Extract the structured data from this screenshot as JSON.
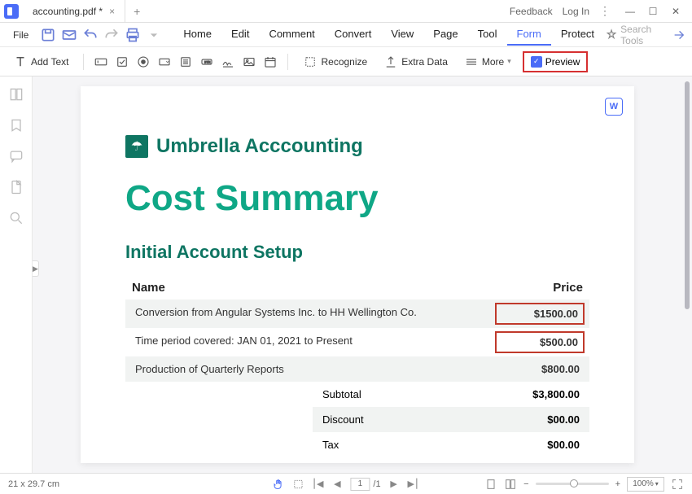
{
  "titlebar": {
    "tab": "accounting.pdf *",
    "feedback": "Feedback",
    "login": "Log In"
  },
  "menubar": {
    "file": "File",
    "items": [
      "Home",
      "Edit",
      "Comment",
      "Convert",
      "View",
      "Page",
      "Tool",
      "Form",
      "Protect"
    ],
    "active_index": 7,
    "search_placeholder": "Search Tools"
  },
  "toolbar": {
    "add_text": "Add Text",
    "recognize": "Recognize",
    "extra_data": "Extra Data",
    "more": "More",
    "preview": "Preview"
  },
  "document": {
    "brand": "Umbrella Acccounting",
    "title": "Cost Summary",
    "section": "Initial Account Setup",
    "headers": {
      "name": "Name",
      "price": "Price"
    },
    "rows": [
      {
        "name": "Conversion from Angular Systems Inc. to HH Wellington Co.",
        "price": "$1500.00",
        "highlight": true,
        "shade": true
      },
      {
        "name": "Time period covered: JAN 01, 2021 to Present",
        "price": "$500.00",
        "highlight": true,
        "shade": false
      },
      {
        "name": "Production of Quarterly Reports",
        "price": "$800.00",
        "highlight": false,
        "shade": true
      }
    ],
    "summary": [
      {
        "label": "Subtotal",
        "value": "$3,800.00",
        "shade": false
      },
      {
        "label": "Discount",
        "value": "$00.00",
        "shade": true
      },
      {
        "label": "Tax",
        "value": "$00.00",
        "shade": false
      }
    ]
  },
  "statusbar": {
    "dims": "21 x 29.7 cm",
    "page_current": "1",
    "page_total": "/1",
    "zoom": "100%"
  }
}
